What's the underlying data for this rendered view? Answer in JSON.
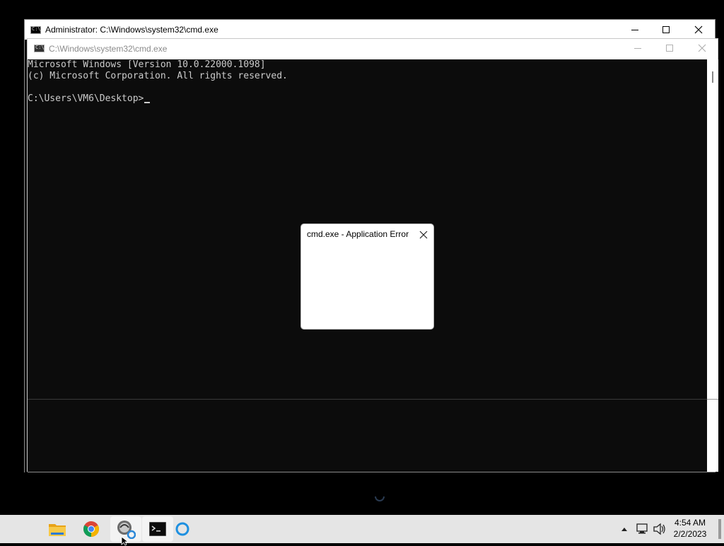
{
  "outer_window": {
    "title": "Administrator: C:\\Windows\\system32\\cmd.exe"
  },
  "inner_window": {
    "title": "C:\\Windows\\system32\\cmd.exe",
    "console_lines": [
      "Microsoft Windows [Version 10.0.22000.1098]",
      "(c) Microsoft Corporation. All rights reserved.",
      "",
      "C:\\Users\\VM6\\Desktop>"
    ]
  },
  "dialog": {
    "title": "cmd.exe - Application Error"
  },
  "taskbar": {
    "apps": [
      {
        "name": "file-explorer-icon"
      },
      {
        "name": "chrome-icon"
      },
      {
        "name": "app-icon"
      },
      {
        "name": "terminal-icon"
      },
      {
        "name": "loading-icon"
      }
    ],
    "clock": {
      "time": "4:54 AM",
      "date": "2/2/2023"
    }
  },
  "colors": {
    "console_bg": "#0c0c0c",
    "console_text": "#cccccc",
    "titlebar_bg": "#ffffff",
    "taskbar_bg": "#e5e5e5"
  }
}
